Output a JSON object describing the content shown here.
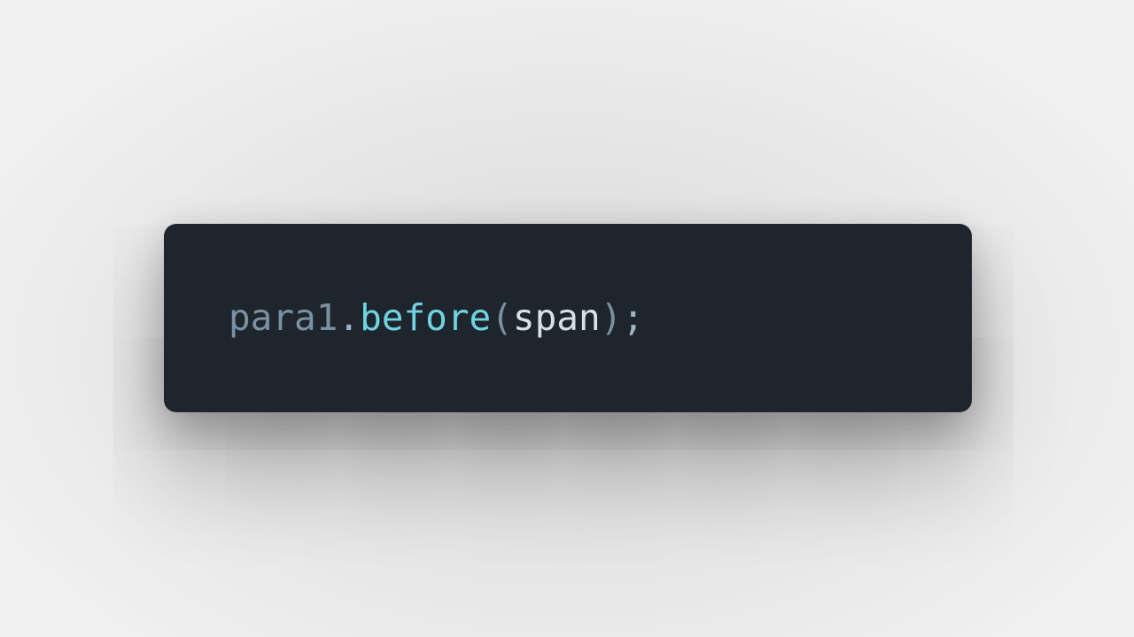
{
  "code": {
    "tokens": {
      "object": "para1",
      "dot": ".",
      "method": "before",
      "open_paren": "(",
      "argument": "span",
      "close_paren": ")",
      "semicolon": ";"
    }
  },
  "colors": {
    "card_background": "#1e252c",
    "object": "#7a91a3",
    "method": "#6fd3e2",
    "argument": "#d6e1ea",
    "punctuation": "#9fb2c2"
  }
}
